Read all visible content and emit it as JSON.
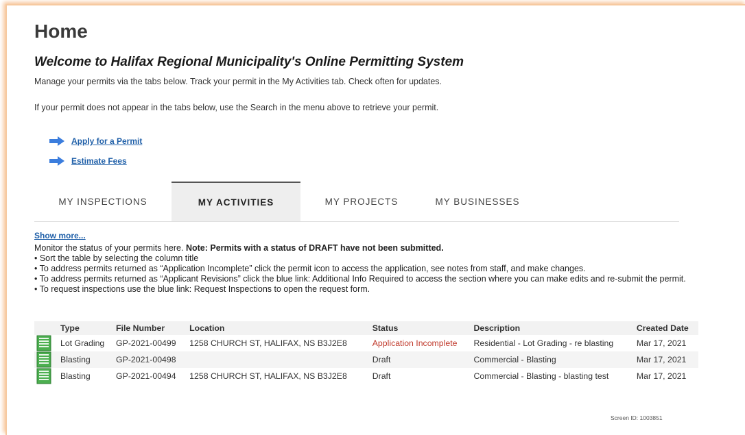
{
  "header": {
    "title": "Home",
    "welcome": "Welcome to Halifax Regional Municipality's Online Permitting System",
    "intro_1": "Manage your permits via the tabs below. Track your permit in the My Activities tab. Check often for updates.",
    "intro_2": "If your permit does not appear in the tabs below, use the Search in the menu above to retrieve your permit."
  },
  "quick_links": {
    "apply": "Apply for a Permit",
    "estimate": "Estimate Fees"
  },
  "tabs": {
    "inspections": "MY INSPECTIONS",
    "activities": "MY ACTIVITIES",
    "projects": "MY PROJECTS",
    "businesses": "MY BUSINESSES"
  },
  "activities": {
    "show_more": "Show more...",
    "monitor_text": "Monitor the status of your permits here. ",
    "monitor_note": "Note: Permits with a status of DRAFT have not been submitted.",
    "bullets": [
      "• Sort the table by selecting the column title",
      "• To address permits returned as “Application Incomplete” click the permit icon to access the application, see notes from staff, and make changes.",
      "• To address permits returned as “Applicant Revisions” click the blue link: Additional Info Required to access the section where you can make edits and re-submit the permit.",
      "• To request inspections use the blue link: Request Inspections to open the request form."
    ]
  },
  "table": {
    "headers": {
      "type": "Type",
      "file_number": "File Number",
      "location": "Location",
      "status": "Status",
      "description": "Description",
      "created_date": "Created Date"
    },
    "rows": [
      {
        "type": "Lot Grading",
        "file_number": "GP-2021-00499",
        "location": "1258 CHURCH ST, HALIFAX, NS B3J2E8",
        "status": "Application Incomplete",
        "description": "Residential - Lot Grading - re blasting",
        "created_date": "Mar 17, 2021"
      },
      {
        "type": "Blasting",
        "file_number": "GP-2021-00498",
        "location": "",
        "status": "Draft",
        "description": "Commercial - Blasting",
        "created_date": "Mar 17, 2021"
      },
      {
        "type": "Blasting",
        "file_number": "GP-2021-00494",
        "location": "1258 CHURCH ST, HALIFAX, NS B3J2E8",
        "status": "Draft",
        "description": "Commercial - Blasting - blasting test",
        "created_date": "Mar 17, 2021"
      }
    ]
  },
  "footer": {
    "screen_id": "Screen ID: 1003851"
  },
  "colors": {
    "link": "#1f5fa8",
    "status_incomplete": "#c0392b",
    "permit_icon": "#4caf50",
    "arrow_icon": "#3b7ddd"
  }
}
